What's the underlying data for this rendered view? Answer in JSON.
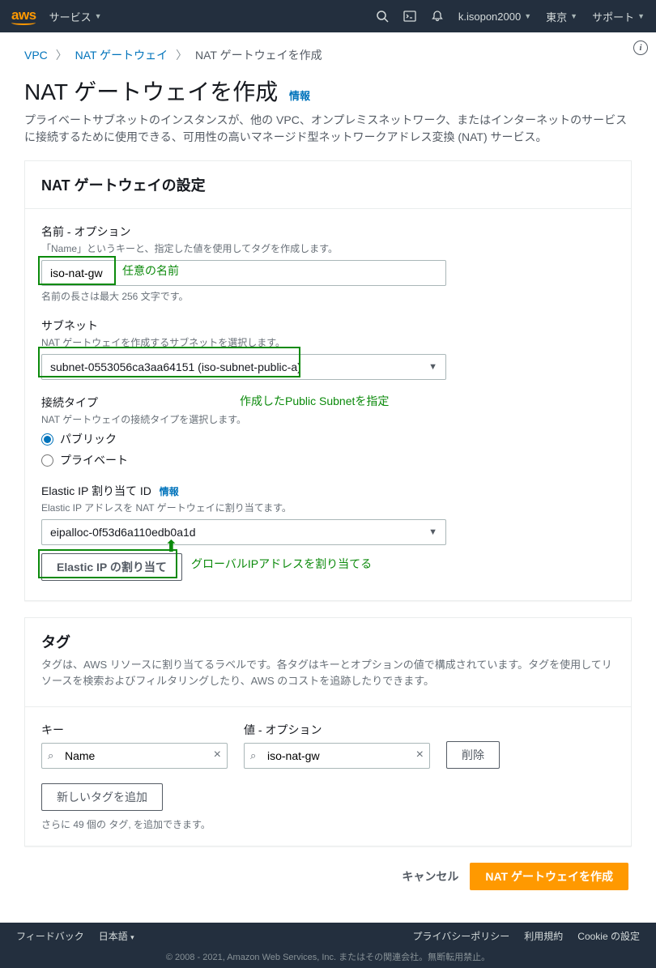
{
  "nav": {
    "logo": "aws",
    "services": "サービス",
    "user": "k.isopon2000",
    "region": "東京",
    "support": "サポート"
  },
  "breadcrumb": {
    "vpc": "VPC",
    "natgw": "NAT ゲートウェイ",
    "current": "NAT ゲートウェイを作成"
  },
  "page": {
    "title": "NAT ゲートウェイを作成",
    "info": "情報",
    "desc": "プライベートサブネットのインスタンスが、他の VPC、オンプレミスネットワーク、またはインターネットのサービスに接続するために使用できる、可用性の高いマネージド型ネットワークアドレス変換 (NAT) サービス。"
  },
  "settings": {
    "header": "NAT ゲートウェイの設定",
    "name_label": "名前 - オプション",
    "name_hint": "「Name」というキーと、指定した値を使用してタグを作成します。",
    "name_value": "iso-nat-gw",
    "name_note": "名前の長さは最大 256 文字です。",
    "subnet_label": "サブネット",
    "subnet_hint": "NAT ゲートウェイを作成するサブネットを選択します。",
    "subnet_value": "subnet-0553056ca3aa64151 (iso-subnet-public-a)",
    "conn_label": "接続タイプ",
    "conn_hint": "NAT ゲートウェイの接続タイプを選択します。",
    "conn_public": "パブリック",
    "conn_private": "プライベート",
    "eip_label": "Elastic IP 割り当て ID",
    "eip_info": "情報",
    "eip_hint": "Elastic IP アドレスを NAT ゲートウェイに割り当てます。",
    "eip_value": "eipalloc-0f53d6a110edb0a1d",
    "eip_button": "Elastic IP の割り当て"
  },
  "annotations": {
    "name": "任意の名前",
    "subnet": "作成したPublic Subnetを指定",
    "eip": "グローバルIPアドレスを割り当てる"
  },
  "tags": {
    "header": "タグ",
    "desc": "タグは、AWS リソースに割り当てるラベルです。各タグはキーとオプションの値で構成されています。タグを使用してリソースを検索およびフィルタリングしたり、AWS のコストを追跡したりできます。",
    "key_label": "キー",
    "value_label": "値 - オプション",
    "key_value": "Name",
    "value_value": "iso-nat-gw",
    "delete": "削除",
    "add": "新しいタグを追加",
    "remaining": "さらに 49 個の タグ, を追加できます。"
  },
  "actions": {
    "cancel": "キャンセル",
    "create": "NAT ゲートウェイを作成"
  },
  "footer": {
    "feedback": "フィードバック",
    "lang": "日本語",
    "copy": "© 2008 - 2021, Amazon Web Services, Inc. またはその関連会社。無断転用禁止。",
    "privacy": "プライバシーポリシー",
    "terms": "利用規約",
    "cookie": "Cookie の設定"
  }
}
